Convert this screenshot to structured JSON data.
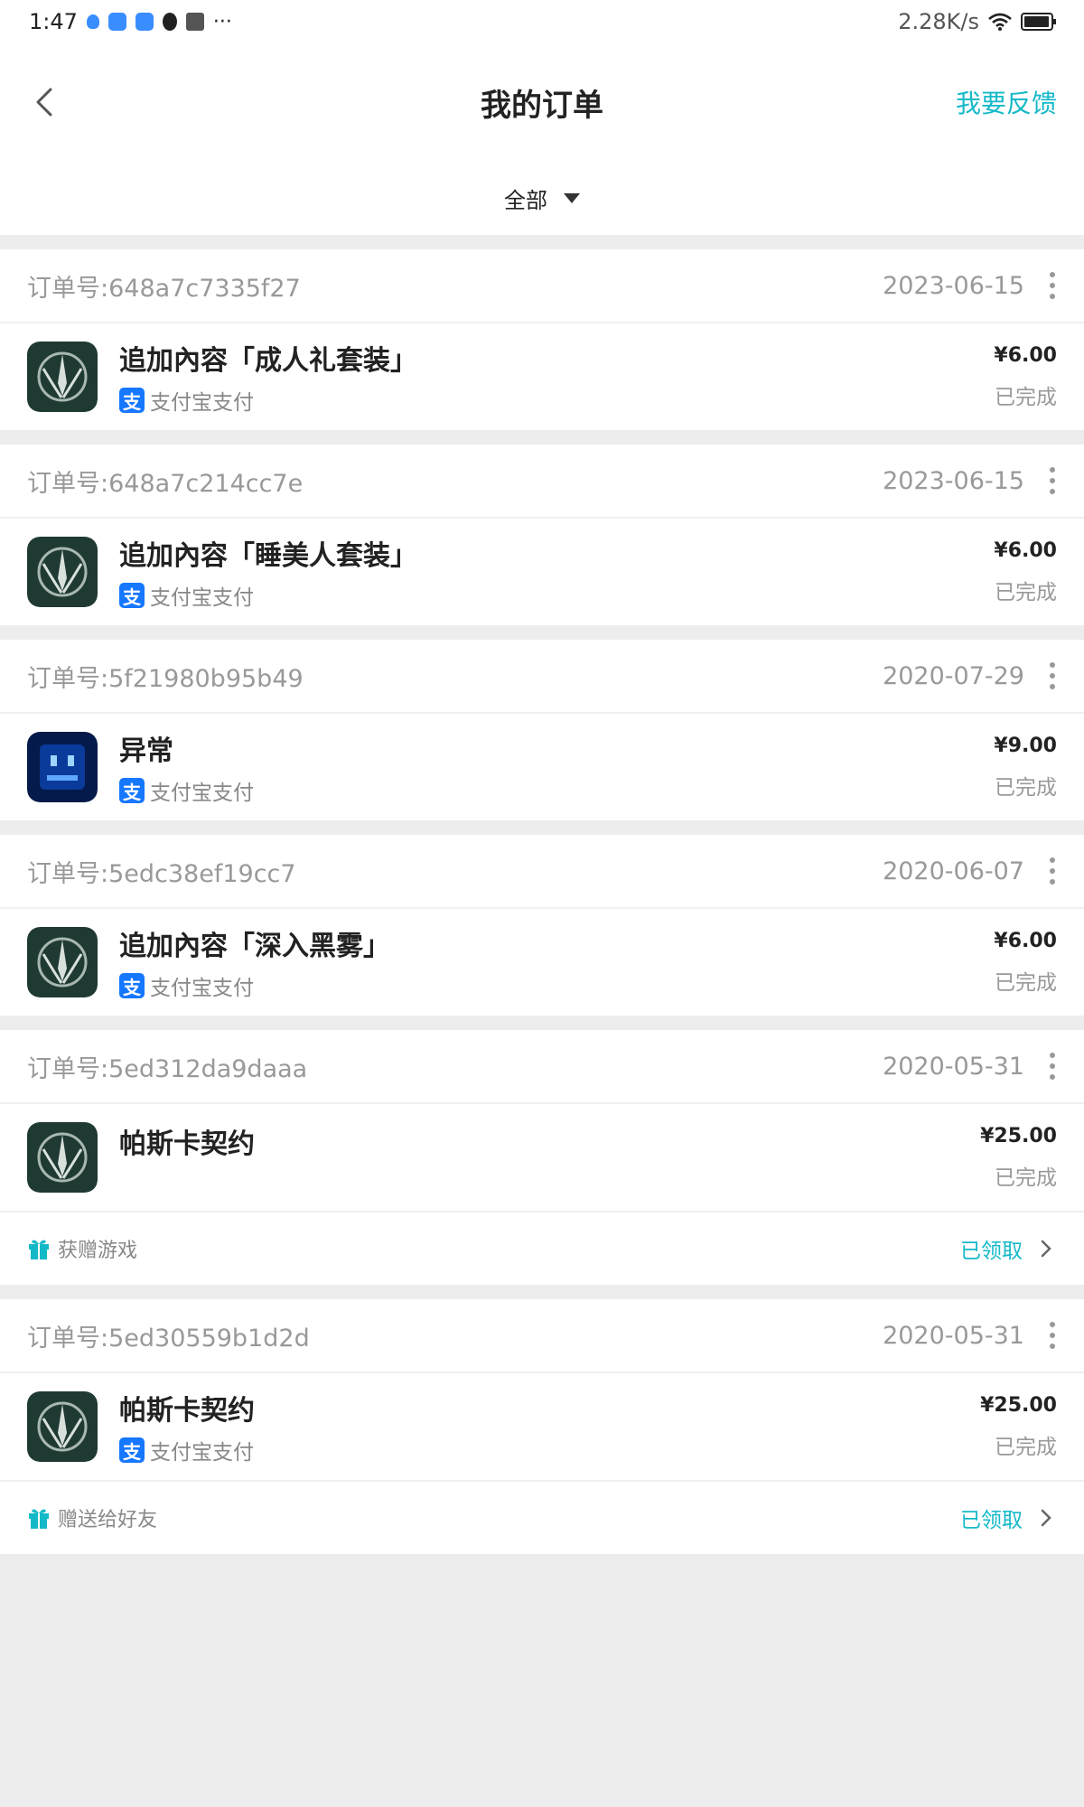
{
  "status_bar": {
    "time": "1:47",
    "net_speed": "2.28K/s"
  },
  "nav": {
    "title": "我的订单",
    "feedback": "我要反馈"
  },
  "filter": {
    "label": "全部"
  },
  "orders": [
    {
      "order_label": "订单号:",
      "order_id": "648a7c7335f27",
      "date": "2023-06-15",
      "app_icon": "dark-green-emblem-icon",
      "title": "追加內容「成人礼套装」",
      "pay_method": "支付宝支付",
      "price": "¥6.00",
      "status": "已完成"
    },
    {
      "order_label": "订单号:",
      "order_id": "648a7c214cc7e",
      "date": "2023-06-15",
      "app_icon": "dark-green-emblem-icon",
      "title": "追加內容「睡美人套装」",
      "pay_method": "支付宝支付",
      "price": "¥6.00",
      "status": "已完成"
    },
    {
      "order_label": "订单号:",
      "order_id": "5f21980b95b49",
      "date": "2020-07-29",
      "app_icon": "blue-pixel-face-icon",
      "title": "异常",
      "pay_method": "支付宝支付",
      "price": "¥9.00",
      "status": "已完成"
    },
    {
      "order_label": "订单号:",
      "order_id": "5edc38ef19cc7",
      "date": "2020-06-07",
      "app_icon": "dark-green-emblem-icon",
      "title": "追加內容「深入黑雾」",
      "pay_method": "支付宝支付",
      "price": "¥6.00",
      "status": "已完成"
    },
    {
      "order_label": "订单号:",
      "order_id": "5ed312da9daaa",
      "date": "2020-05-31",
      "app_icon": "dark-green-emblem-icon",
      "title": "帕斯卡契约",
      "pay_method": "",
      "price": "¥25.00",
      "status": "已完成",
      "footer_left": "获赠游戏",
      "footer_right": "已领取"
    },
    {
      "order_label": "订单号:",
      "order_id": "5ed30559b1d2d",
      "date": "2020-05-31",
      "app_icon": "dark-green-emblem-icon",
      "title": "帕斯卡契约",
      "pay_method": "支付宝支付",
      "price": "¥25.00",
      "status": "已完成",
      "footer_left": "赠送给好友",
      "footer_right": "已领取"
    }
  ],
  "colors": {
    "accent": "#14b9c8",
    "alipay": "#1677ff",
    "page_bg": "#ededed"
  }
}
